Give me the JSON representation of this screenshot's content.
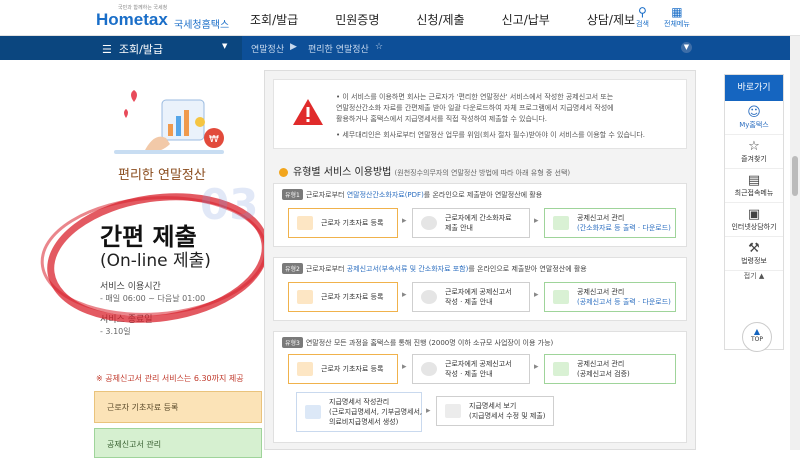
{
  "header": {
    "logo_tagline": "국민과 함께하는 국세청",
    "logo_name": "Hometax",
    "logo_sub": "국세청홈택스",
    "menu": [
      "조회/발급",
      "민원증명",
      "신청/제출",
      "신고/납부",
      "상담/제보"
    ],
    "search_label": "검색",
    "allmenu_label": "전체메뉴"
  },
  "breadcrumb": {
    "section": "조회/발급",
    "level1": "연말정산",
    "level2": "편리한 연말정산"
  },
  "left": {
    "title": "편리한 연말정산",
    "headline": "간편 제출",
    "headline_sub": "(On-line 제출)",
    "service_hours_label": "서비스 이용시간",
    "service_hours_value": "- 매일 06:00 ~ 다음날 01:00",
    "service_end_label": "서비스 종료일",
    "service_end_value": "- 3.10일",
    "red_notice": "※ 공제신고서 관리 서비스는 6.30까지 제공",
    "btn_employee_register": "근로자 기초자료 등록",
    "btn_deduction_manage": "공제신고서 관리"
  },
  "notice": {
    "line1": "• 이 서비스를 이용하면 회사는 근로자가 '편리한 연말정산' 서비스에서 작성한 공제신고서 또는",
    "line2": "  연말정산간소화 자료를 간편제출 받아 일괄 다운로드하여 자체 프로그램에서 지급명세서 작성에",
    "line3": "  활용하거나 홈택스에서 지급명세서를 직접 작성하여 제출할 수 있습니다.",
    "line4": "• 세무대리인은 회사로부터 연말정산 업무를 위임(회사 절차 필수)받아야 이 서비스를 이용할 수 있습니다."
  },
  "section": {
    "title": "유형별 서비스 이용방법",
    "subtitle": "(원천징수의무자의 연말정산 방법에 따라 아래 유형 중 선택)"
  },
  "types": [
    {
      "badge": "유형1",
      "desc_pre": "근로자로부터 ",
      "desc_hl": "연말정산간소화자료(PDF)",
      "desc_post": "를 온라인으로 제출받아 연말정산에 활용",
      "steps": [
        [
          "근로자 기초자료 등록"
        ],
        [
          "근로자에게 간소화자료",
          "제출 안내"
        ],
        [
          "공제신고서 관리",
          "(간소화자료 등 출력 · 다운로드)"
        ]
      ]
    },
    {
      "badge": "유형2",
      "desc_pre": "근로자로부터 ",
      "desc_hl": "공제신고서(부속서류 및 간소화자료 포함)",
      "desc_post": "를 온라인으로 제출받아 연말정산에 활용",
      "steps": [
        [
          "근로자 기초자료 등록"
        ],
        [
          "근로자에게 공제신고서",
          "작성 · 제출 안내"
        ],
        [
          "공제신고서 관리",
          "(공제신고서 등 출력 · 다운로드)"
        ]
      ]
    },
    {
      "badge": "유형3",
      "desc_pre": "연말정산 모든 과정을 홈택스를 통해 진행 (2000명 이하 소규모 사업장이 이용 가능)",
      "desc_hl": "",
      "desc_post": "",
      "steps": [
        [
          "근로자 기초자료 등록"
        ],
        [
          "근로자에게 공제신고서",
          "작성 · 제출 안내"
        ],
        [
          "공제신고서 관리",
          "(공제신고서 검증)"
        ],
        [
          "지급명세서 작성관리",
          "(근로지급명세서, 기부금명세서,",
          "의료비지급명세서 생성)"
        ],
        [
          "지급명세서 보기",
          "(지급명세서 수정 및 제출)"
        ]
      ]
    }
  ],
  "sidebar": {
    "title": "바로가기",
    "items": [
      "My홈택스",
      "즐겨찾기",
      "최근접속메뉴",
      "인터넷상담하기",
      "법령정보"
    ],
    "fold": "접기 ▲",
    "top": "TOP"
  },
  "watermark": "03",
  "colors": {
    "navy_bar": "#0d4f98",
    "sidebar_header": "#1565c0",
    "orange_step": "#f0b24c",
    "green_step": "#9fd49a",
    "red_circle": "#d9232e"
  }
}
